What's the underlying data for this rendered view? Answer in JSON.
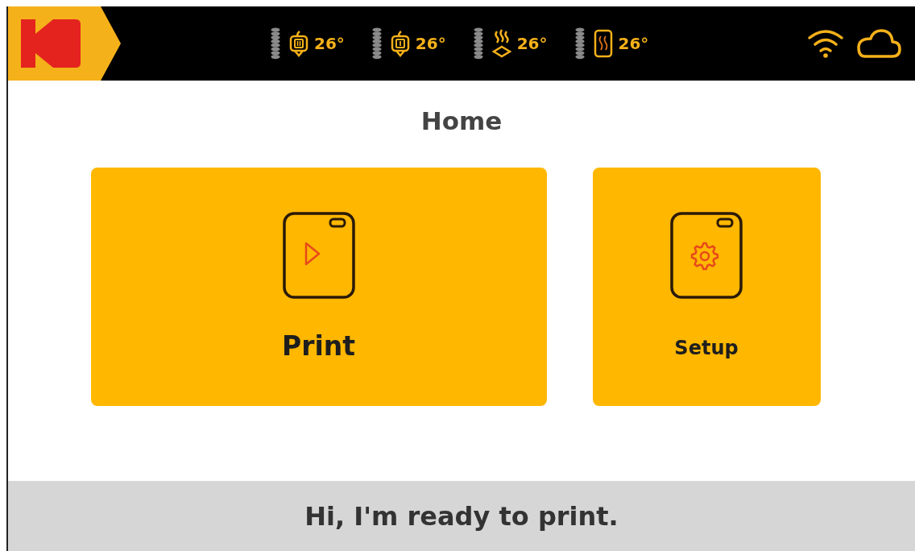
{
  "status_bar": {
    "temperatures": [
      {
        "kind": "nozzle-2",
        "reading": "26°"
      },
      {
        "kind": "nozzle-1",
        "reading": "26°"
      },
      {
        "kind": "chamber",
        "reading": "26°"
      },
      {
        "kind": "bed",
        "reading": "26°"
      }
    ]
  },
  "title": "Home",
  "tiles": [
    {
      "kind": "print",
      "label": "Print"
    },
    {
      "kind": "setup",
      "label": "Setup"
    }
  ],
  "message": "Hi, I'm ready to print."
}
